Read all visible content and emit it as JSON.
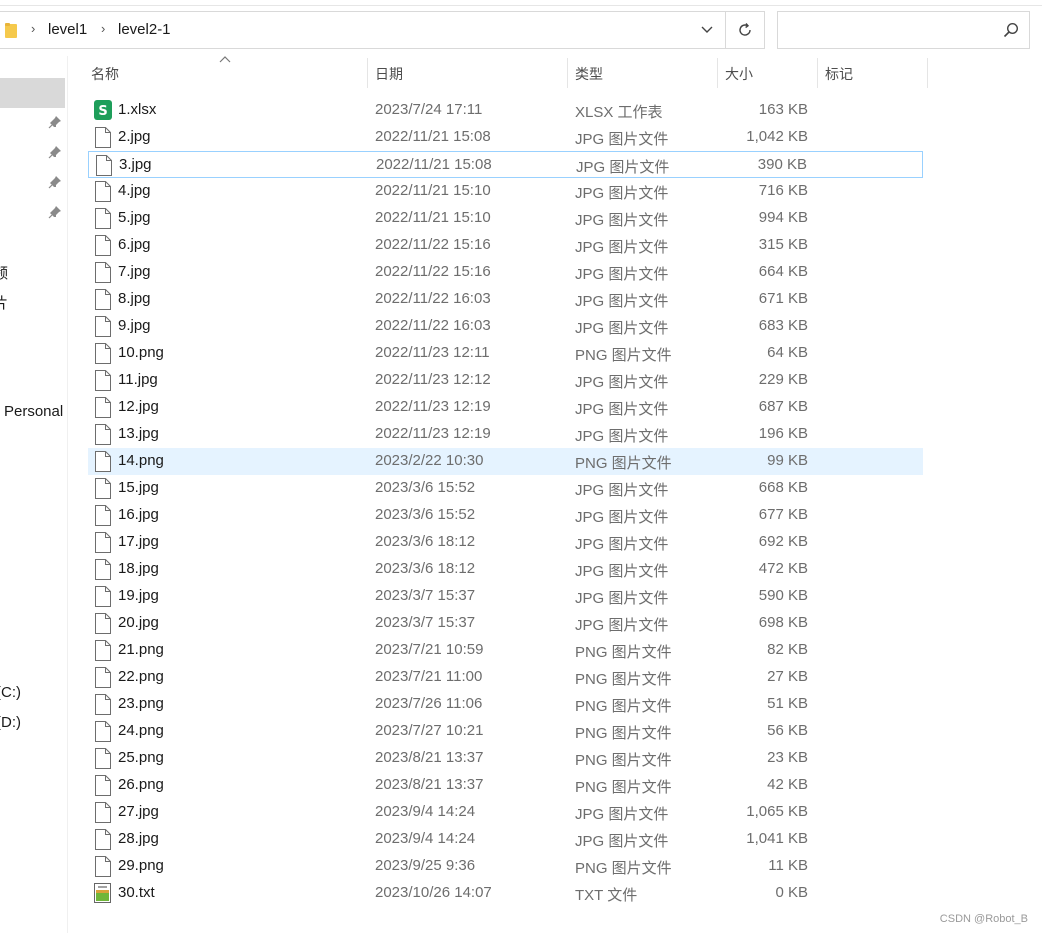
{
  "address": {
    "crumbs": [
      "level1",
      "level2-1"
    ]
  },
  "search": {
    "placeholder": "",
    "value": ""
  },
  "nav": {
    "items": [
      "频",
      "片",
      "Personal",
      "(C:)",
      "(D:)"
    ]
  },
  "columns": {
    "name": "名称",
    "date": "日期",
    "type": "类型",
    "size": "大小",
    "tag": "标记"
  },
  "files": [
    {
      "name": "1.xlsx",
      "date": "2023/7/24 17:11",
      "type": "XLSX 工作表",
      "size": "163 KB",
      "icon": "spreadsheet-icon"
    },
    {
      "name": "2.jpg",
      "date": "2022/11/21 15:08",
      "type": "JPG 图片文件",
      "size": "1,042 KB",
      "icon": "file-icon"
    },
    {
      "name": "3.jpg",
      "date": "2022/11/21 15:08",
      "type": "JPG 图片文件",
      "size": "390 KB",
      "icon": "file-icon"
    },
    {
      "name": "4.jpg",
      "date": "2022/11/21 15:10",
      "type": "JPG 图片文件",
      "size": "716 KB",
      "icon": "file-icon"
    },
    {
      "name": "5.jpg",
      "date": "2022/11/21 15:10",
      "type": "JPG 图片文件",
      "size": "994 KB",
      "icon": "file-icon"
    },
    {
      "name": "6.jpg",
      "date": "2022/11/22 15:16",
      "type": "JPG 图片文件",
      "size": "315 KB",
      "icon": "file-icon"
    },
    {
      "name": "7.jpg",
      "date": "2022/11/22 15:16",
      "type": "JPG 图片文件",
      "size": "664 KB",
      "icon": "file-icon"
    },
    {
      "name": "8.jpg",
      "date": "2022/11/22 16:03",
      "type": "JPG 图片文件",
      "size": "671 KB",
      "icon": "file-icon"
    },
    {
      "name": "9.jpg",
      "date": "2022/11/22 16:03",
      "type": "JPG 图片文件",
      "size": "683 KB",
      "icon": "file-icon"
    },
    {
      "name": "10.png",
      "date": "2022/11/23 12:11",
      "type": "PNG 图片文件",
      "size": "64 KB",
      "icon": "file-icon"
    },
    {
      "name": "11.jpg",
      "date": "2022/11/23 12:12",
      "type": "JPG 图片文件",
      "size": "229 KB",
      "icon": "file-icon"
    },
    {
      "name": "12.jpg",
      "date": "2022/11/23 12:19",
      "type": "JPG 图片文件",
      "size": "687 KB",
      "icon": "file-icon"
    },
    {
      "name": "13.jpg",
      "date": "2022/11/23 12:19",
      "type": "JPG 图片文件",
      "size": "196 KB",
      "icon": "file-icon"
    },
    {
      "name": "14.png",
      "date": "2023/2/22 10:30",
      "type": "PNG 图片文件",
      "size": "99 KB",
      "icon": "file-icon"
    },
    {
      "name": "15.jpg",
      "date": "2023/3/6 15:52",
      "type": "JPG 图片文件",
      "size": "668 KB",
      "icon": "file-icon"
    },
    {
      "name": "16.jpg",
      "date": "2023/3/6 15:52",
      "type": "JPG 图片文件",
      "size": "677 KB",
      "icon": "file-icon"
    },
    {
      "name": "17.jpg",
      "date": "2023/3/6 18:12",
      "type": "JPG 图片文件",
      "size": "692 KB",
      "icon": "file-icon"
    },
    {
      "name": "18.jpg",
      "date": "2023/3/6 18:12",
      "type": "JPG 图片文件",
      "size": "472 KB",
      "icon": "file-icon"
    },
    {
      "name": "19.jpg",
      "date": "2023/3/7 15:37",
      "type": "JPG 图片文件",
      "size": "590 KB",
      "icon": "file-icon"
    },
    {
      "name": "20.jpg",
      "date": "2023/3/7 15:37",
      "type": "JPG 图片文件",
      "size": "698 KB",
      "icon": "file-icon"
    },
    {
      "name": "21.png",
      "date": "2023/7/21 10:59",
      "type": "PNG 图片文件",
      "size": "82 KB",
      "icon": "file-icon"
    },
    {
      "name": "22.png",
      "date": "2023/7/21 11:00",
      "type": "PNG 图片文件",
      "size": "27 KB",
      "icon": "file-icon"
    },
    {
      "name": "23.png",
      "date": "2023/7/26 11:06",
      "type": "PNG 图片文件",
      "size": "51 KB",
      "icon": "file-icon"
    },
    {
      "name": "24.png",
      "date": "2023/7/27 10:21",
      "type": "PNG 图片文件",
      "size": "56 KB",
      "icon": "file-icon"
    },
    {
      "name": "25.png",
      "date": "2023/8/21 13:37",
      "type": "PNG 图片文件",
      "size": "23 KB",
      "icon": "file-icon"
    },
    {
      "name": "26.png",
      "date": "2023/8/21 13:37",
      "type": "PNG 图片文件",
      "size": "42 KB",
      "icon": "file-icon"
    },
    {
      "name": "27.jpg",
      "date": "2023/9/4 14:24",
      "type": "JPG 图片文件",
      "size": "1,065 KB",
      "icon": "file-icon"
    },
    {
      "name": "28.jpg",
      "date": "2023/9/4 14:24",
      "type": "JPG 图片文件",
      "size": "1,041 KB",
      "icon": "file-icon"
    },
    {
      "name": "29.png",
      "date": "2023/9/25 9:36",
      "type": "PNG 图片文件",
      "size": "11 KB",
      "icon": "file-icon"
    },
    {
      "name": "30.txt",
      "date": "2023/10/26 14:07",
      "type": "TXT 文件",
      "size": "0 KB",
      "icon": "text-file-icon"
    }
  ],
  "focused_row": 2,
  "hovered_row": 13,
  "colors": {
    "hover": "#e5f3ff",
    "focus_border": "#99d1ff",
    "spreadsheet": "#1e9e5a",
    "folder": "#f5c94c"
  },
  "watermark": "CSDN @Robot_B"
}
